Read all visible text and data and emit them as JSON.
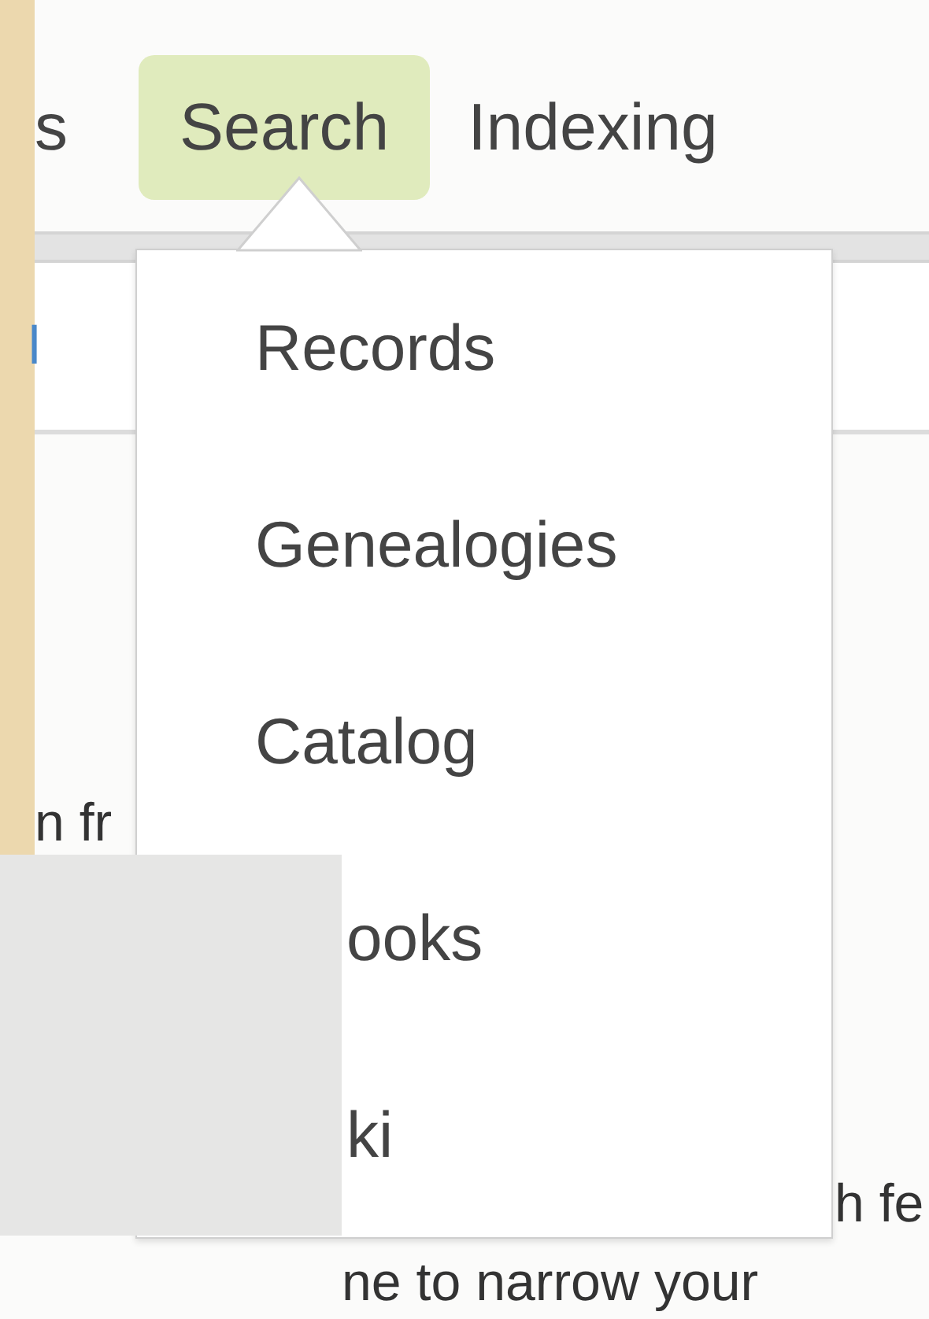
{
  "nav": {
    "items": [
      {
        "label": "s",
        "selected": false
      },
      {
        "label": "Search",
        "selected": true
      },
      {
        "label": "Indexing",
        "selected": false
      }
    ]
  },
  "subnav": {
    "items": [
      "l"
    ]
  },
  "body_fragments": [
    {
      "text": "n fr",
      "kind": "left"
    },
    {
      "text": "h fe",
      "kind": "right"
    },
    {
      "text": "ne to narrow your",
      "kind": "bottom"
    }
  ],
  "dropdown": {
    "items": [
      {
        "label": "Records",
        "kind": "full"
      },
      {
        "label": "Genealogies",
        "kind": "full"
      },
      {
        "label": "Catalog",
        "kind": "full"
      },
      {
        "label": "ooks",
        "kind": "cut"
      },
      {
        "label": "ki",
        "kind": "cut"
      }
    ]
  }
}
